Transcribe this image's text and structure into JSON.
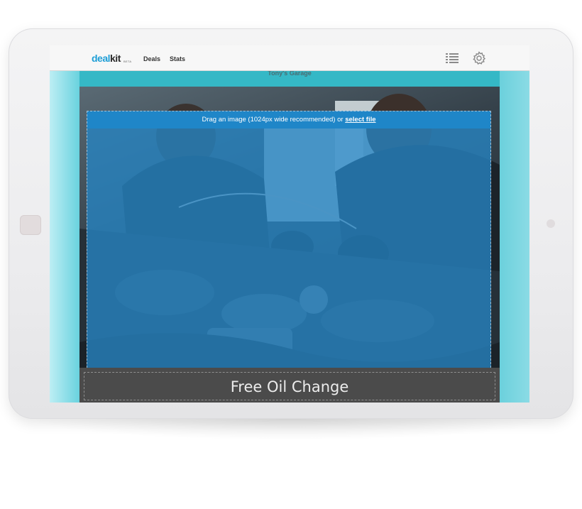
{
  "header": {
    "logo_deal": "deal",
    "logo_kit": "kit",
    "logo_badge": "BETA",
    "nav": [
      {
        "label": "Deals"
      },
      {
        "label": "Stats"
      }
    ],
    "icons": [
      "list-icon",
      "gear-icon"
    ]
  },
  "deal": {
    "business_name": "Tony's Garage",
    "dropzone": {
      "text": "Drag an image (1024px wide recommended) or ",
      "link": "select file"
    },
    "title": "Free Oil Change"
  },
  "colors": {
    "brand_blue": "#1e9ed6",
    "teal_background": "#2fb6c6",
    "dropzone_bar": "#1f86c8",
    "title_bar": "#4b4b4b"
  }
}
